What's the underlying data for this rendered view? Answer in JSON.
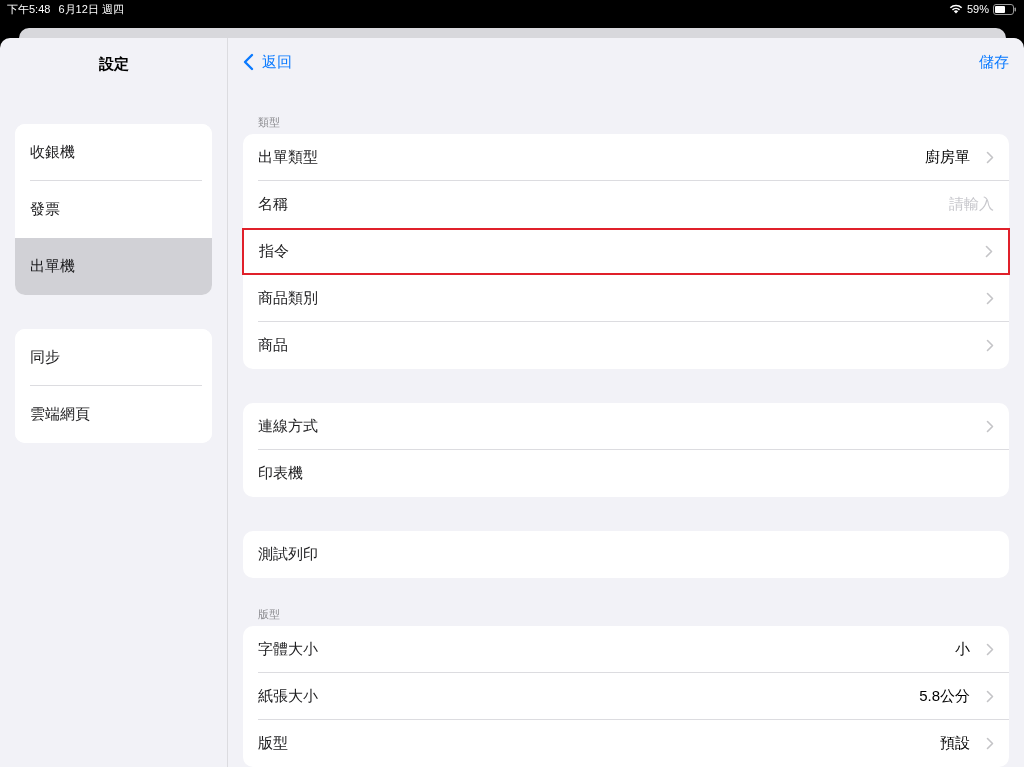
{
  "status_bar": {
    "time": "下午5:48",
    "date": "6月12日 週四",
    "battery": "59%"
  },
  "sidebar": {
    "title": "設定",
    "groups": [
      [
        {
          "label": "收銀機",
          "selected": false
        },
        {
          "label": "發票",
          "selected": false
        },
        {
          "label": "出單機",
          "selected": true
        }
      ],
      [
        {
          "label": "同步",
          "selected": false
        },
        {
          "label": "雲端網頁",
          "selected": false
        }
      ]
    ]
  },
  "detail": {
    "back": "返回",
    "save": "儲存",
    "sections": [
      {
        "header": "類型",
        "rows": [
          {
            "kind": "value",
            "label": "出單類型",
            "value": "廚房單",
            "chevron": true,
            "highlighted": false
          },
          {
            "kind": "input",
            "label": "名稱",
            "placeholder": "請輸入",
            "chevron": false,
            "highlighted": false
          },
          {
            "kind": "plain",
            "label": "指令",
            "chevron": true,
            "highlighted": true
          },
          {
            "kind": "plain",
            "label": "商品類別",
            "chevron": true,
            "highlighted": false
          },
          {
            "kind": "plain",
            "label": "商品",
            "chevron": true,
            "highlighted": false
          }
        ]
      },
      {
        "rows": [
          {
            "kind": "plain",
            "label": "連線方式",
            "chevron": true,
            "highlighted": false
          },
          {
            "kind": "plain",
            "label": "印表機",
            "chevron": false,
            "highlighted": false
          }
        ]
      },
      {
        "rows": [
          {
            "kind": "plain",
            "label": "測試列印",
            "chevron": false,
            "highlighted": false
          }
        ]
      },
      {
        "header": "版型",
        "rows": [
          {
            "kind": "value",
            "label": "字體大小",
            "value": "小",
            "chevron": true,
            "highlighted": false
          },
          {
            "kind": "value",
            "label": "紙張大小",
            "value": "5.8公分",
            "chevron": true,
            "highlighted": false
          },
          {
            "kind": "value",
            "label": "版型",
            "value": "預設",
            "chevron": true,
            "highlighted": false
          }
        ]
      }
    ]
  }
}
